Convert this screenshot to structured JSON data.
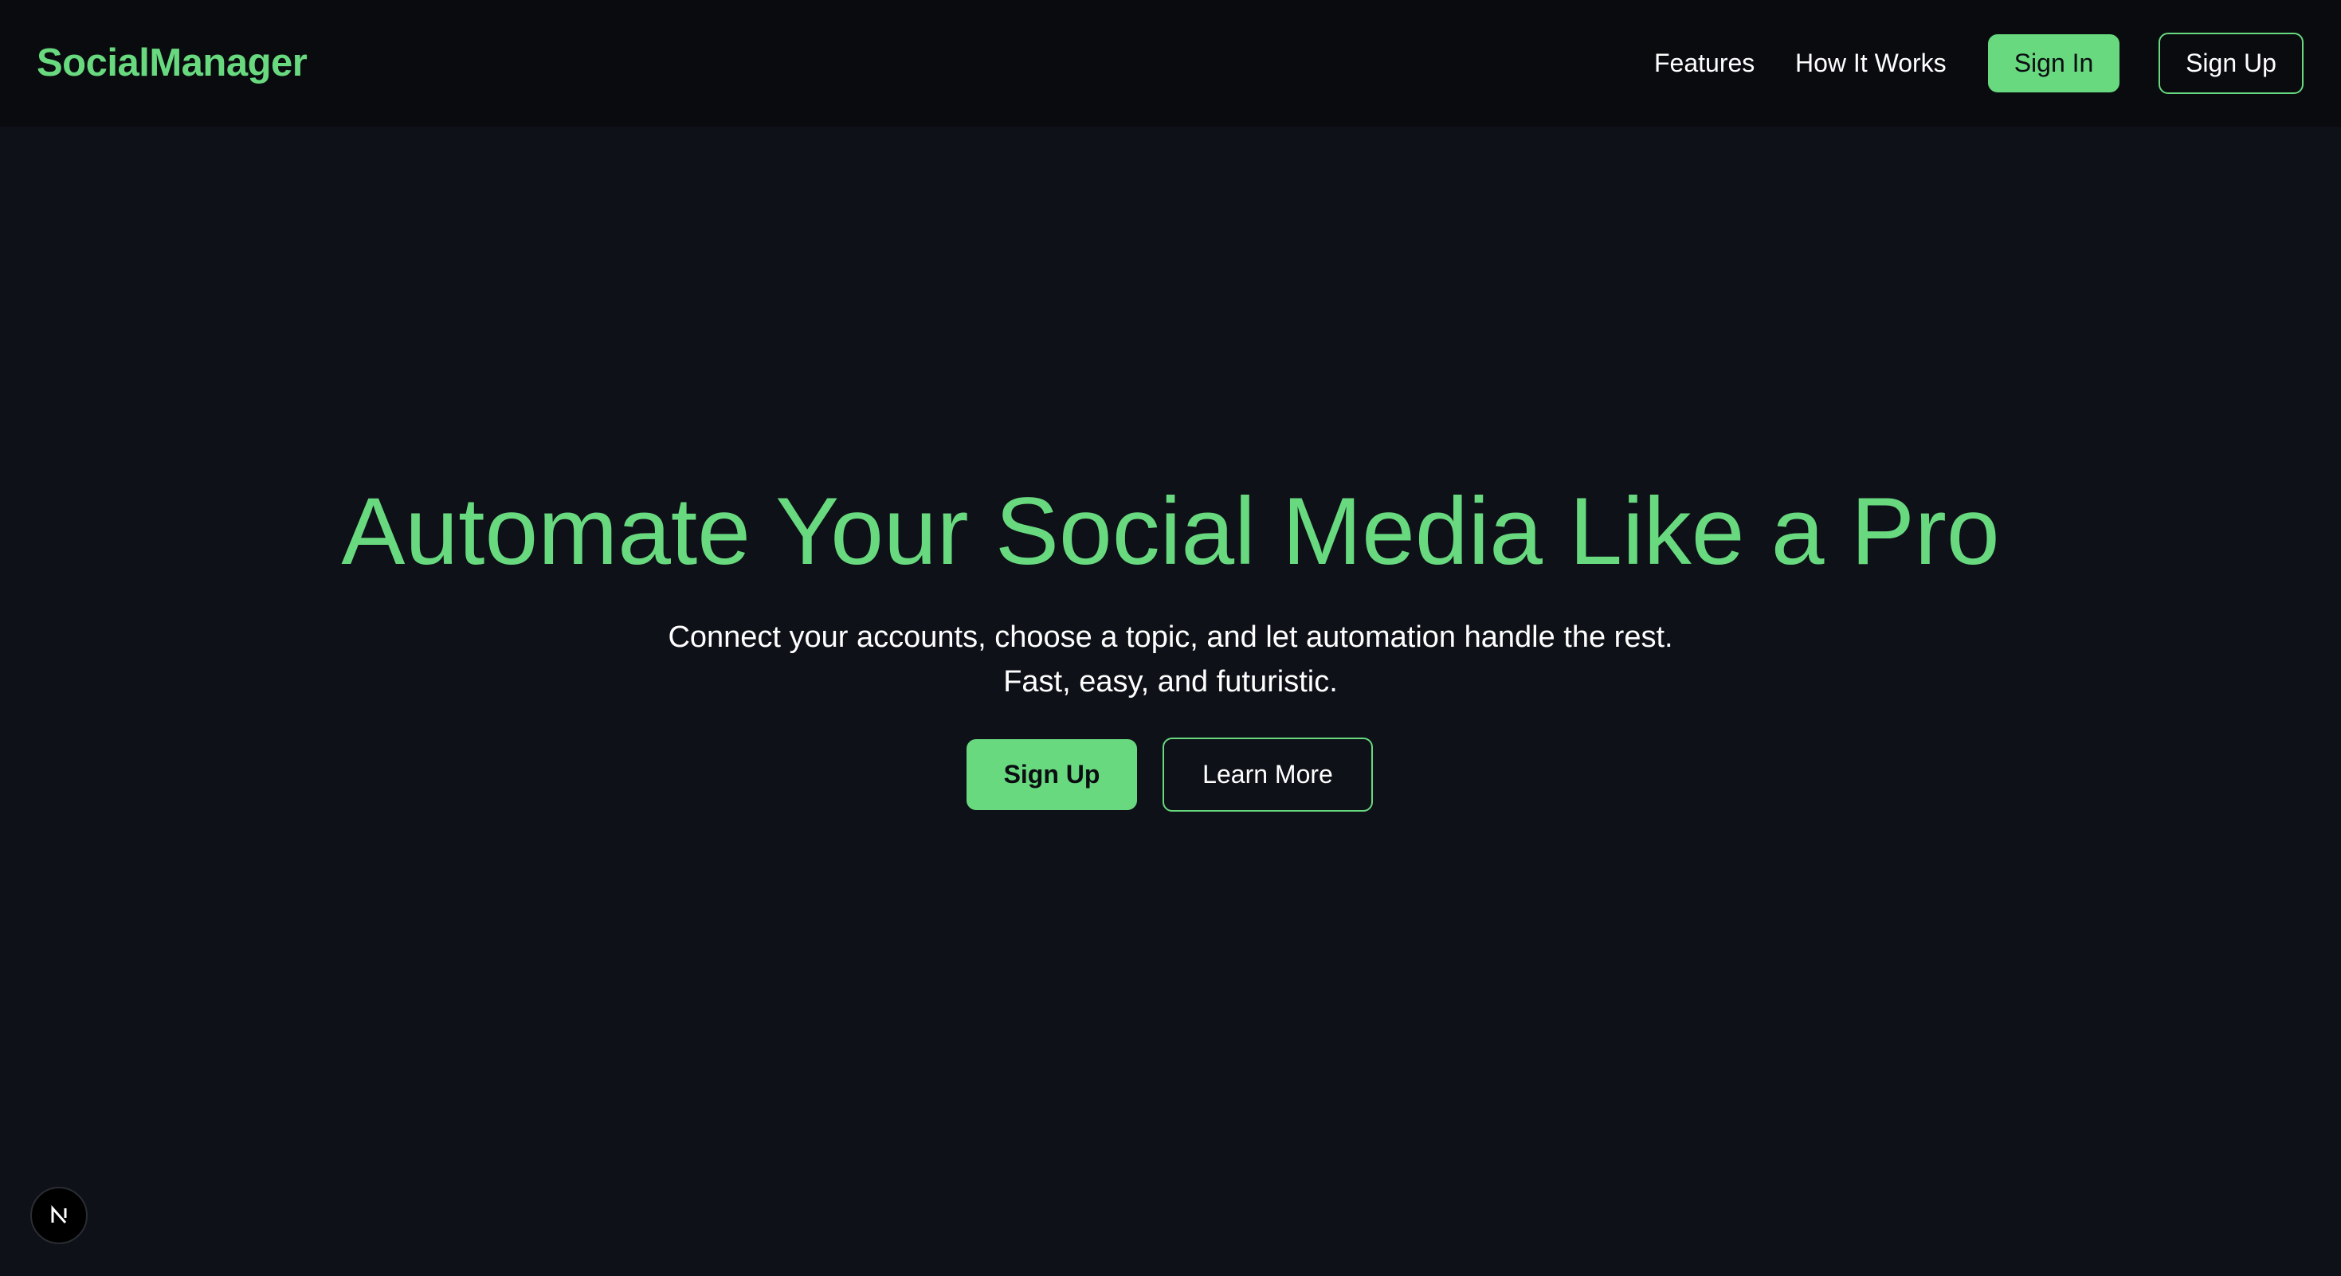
{
  "header": {
    "brand": "SocialManager",
    "nav_links": [
      "Features",
      "How It Works"
    ],
    "sign_in_label": "Sign In",
    "sign_up_label": "Sign Up"
  },
  "hero": {
    "title": "Automate Your Social Media Like a Pro",
    "subtitle": "Connect your accounts, choose a topic, and let automation handle the rest. Fast, easy, and futuristic.",
    "primary_cta": "Sign Up",
    "secondary_cta": "Learn More"
  },
  "corner_badge": {
    "icon": "nextjs-n-icon"
  },
  "colors": {
    "accent": "#68d97f",
    "background": "#0e1118",
    "navbar_background": "#090b0f",
    "text": "#ffffff"
  }
}
